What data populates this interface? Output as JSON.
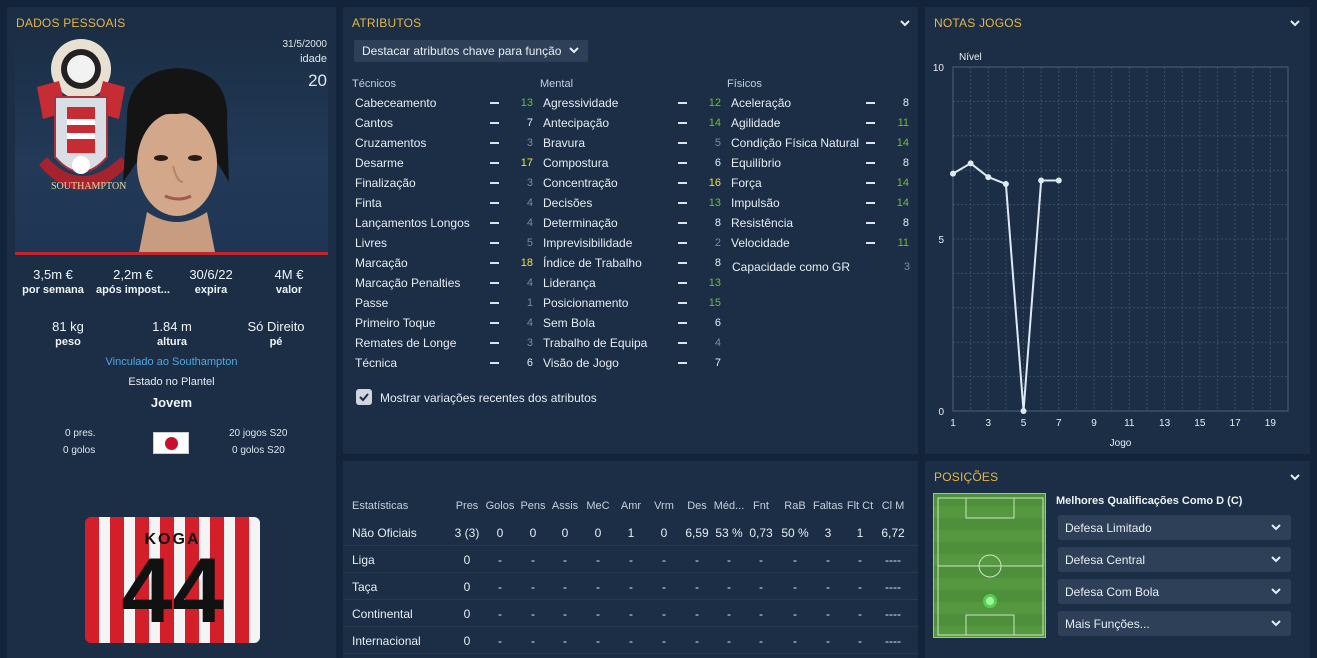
{
  "personal": {
    "title": "DADOS PESSOAIS",
    "dob": "31/5/2000",
    "age_label": "idade",
    "age": "20",
    "wage": {
      "value": "3,5m €",
      "label": "por semana"
    },
    "after_tax": {
      "value": "2,2m €",
      "label": "após impost..."
    },
    "contract": {
      "value": "30/6/22",
      "label": "expira"
    },
    "market_value": {
      "value": "4M €",
      "label": "valor"
    },
    "weight": {
      "value": "81 kg",
      "label": "peso"
    },
    "height": {
      "value": "1.84 m",
      "label": "altura"
    },
    "foot": {
      "value": "Só Direito",
      "label": "pé"
    },
    "club_link": "Vinculado ao Southampton",
    "squad_status_label": "Estado no Plantel",
    "squad_status": "Jovem",
    "caps": "0 pres.",
    "goals": "0 golos",
    "season_games": "20 jogos S20",
    "season_goals": "0 golos S20",
    "shirt_name": "KOGA",
    "shirt_number": "44",
    "crest_text": "SOUTHAMPTON"
  },
  "attributes": {
    "title": "ATRIBUTOS",
    "dropdown": "Destacar atributos chave para função",
    "columns": [
      "Técnicos",
      "Mental",
      "Físicos"
    ],
    "technical": [
      {
        "name": "Cabeceamento",
        "value": "13",
        "c": "#6dbe3a"
      },
      {
        "name": "Cantos",
        "value": "7",
        "c": "#e8edf2"
      },
      {
        "name": "Cruzamentos",
        "value": "3",
        "c": "#7f8b98"
      },
      {
        "name": "Desarme",
        "value": "17",
        "c": "#f2e33c"
      },
      {
        "name": "Finalização",
        "value": "3",
        "c": "#7f8b98"
      },
      {
        "name": "Finta",
        "value": "4",
        "c": "#7f8b98"
      },
      {
        "name": "Lançamentos Longos",
        "value": "4",
        "c": "#7f8b98"
      },
      {
        "name": "Livres",
        "value": "5",
        "c": "#7f8b98"
      },
      {
        "name": "Marcação",
        "value": "18",
        "c": "#f2e33c"
      },
      {
        "name": "Marcação Penalties",
        "value": "4",
        "c": "#7f8b98"
      },
      {
        "name": "Passe",
        "value": "1",
        "c": "#7f8b98"
      },
      {
        "name": "Primeiro Toque",
        "value": "4",
        "c": "#7f8b98"
      },
      {
        "name": "Remates de Longe",
        "value": "3",
        "c": "#7f8b98"
      },
      {
        "name": "Técnica",
        "value": "6",
        "c": "#e8edf2"
      }
    ],
    "mental": [
      {
        "name": "Agressividade",
        "value": "12",
        "c": "#6dbe3a"
      },
      {
        "name": "Antecipação",
        "value": "14",
        "c": "#6dbe3a"
      },
      {
        "name": "Bravura",
        "value": "5",
        "c": "#7f8b98"
      },
      {
        "name": "Compostura",
        "value": "6",
        "c": "#e8edf2"
      },
      {
        "name": "Concentração",
        "value": "16",
        "c": "#f2e33c"
      },
      {
        "name": "Decisões",
        "value": "13",
        "c": "#6dbe3a"
      },
      {
        "name": "Determinação",
        "value": "8",
        "c": "#e8edf2"
      },
      {
        "name": "Imprevisibilidade",
        "value": "2",
        "c": "#7f8b98"
      },
      {
        "name": "Índice de Trabalho",
        "value": "8",
        "c": "#e8edf2"
      },
      {
        "name": "Liderança",
        "value": "13",
        "c": "#6dbe3a"
      },
      {
        "name": "Posicionamento",
        "value": "15",
        "c": "#6dbe3a"
      },
      {
        "name": "Sem Bola",
        "value": "6",
        "c": "#e8edf2"
      },
      {
        "name": "Trabalho de Equipa",
        "value": "4",
        "c": "#7f8b98"
      },
      {
        "name": "Visão de Jogo",
        "value": "7",
        "c": "#e8edf2"
      }
    ],
    "physical": [
      {
        "name": "Aceleração",
        "value": "8",
        "c": "#e8edf2"
      },
      {
        "name": "Agilidade",
        "value": "11",
        "c": "#6dbe3a"
      },
      {
        "name": "Condição Física Natural",
        "value": "14",
        "c": "#6dbe3a"
      },
      {
        "name": "Equilíbrio",
        "value": "8",
        "c": "#e8edf2"
      },
      {
        "name": "Força",
        "value": "14",
        "c": "#6dbe3a"
      },
      {
        "name": "Impulsão",
        "value": "14",
        "c": "#6dbe3a"
      },
      {
        "name": "Resistência",
        "value": "8",
        "c": "#e8edf2"
      },
      {
        "name": "Velocidade",
        "value": "11",
        "c": "#6dbe3a"
      }
    ],
    "gk_label": "Capacidade como GR",
    "gk_value": "3",
    "checkbox_label": "Mostrar variações recentes dos atributos",
    "checkbox_checked": true
  },
  "stats": {
    "headers": [
      "Estatísticas",
      "Pres",
      "Golos",
      "Pens",
      "Assis",
      "MeC",
      "Amr",
      "Vrm",
      "Des",
      "Méd...",
      "Fnt",
      "RaB",
      "Faltas",
      "Flt Ct",
      "Cl M"
    ],
    "rows": [
      [
        "Não Oficiais",
        "3 (3)",
        "0",
        "0",
        "0",
        "0",
        "1",
        "0",
        "6,59",
        "53 %",
        "0,73",
        "50 %",
        "3",
        "1",
        "6,72"
      ],
      [
        "Liga",
        "0",
        "-",
        "-",
        "-",
        "-",
        "-",
        "-",
        "-",
        "-",
        "-",
        "-",
        "-",
        "-",
        "----"
      ],
      [
        "Taça",
        "0",
        "-",
        "-",
        "-",
        "-",
        "-",
        "-",
        "-",
        "-",
        "-",
        "-",
        "-",
        "-",
        "----"
      ],
      [
        "Continental",
        "0",
        "-",
        "-",
        "-",
        "-",
        "-",
        "-",
        "-",
        "-",
        "-",
        "-",
        "-",
        "-",
        "----"
      ],
      [
        "Internacional",
        "0",
        "-",
        "-",
        "-",
        "-",
        "-",
        "-",
        "-",
        "-",
        "-",
        "-",
        "-",
        "-",
        "----"
      ]
    ]
  },
  "chart_data": {
    "type": "line",
    "title": "NOTAS JOGOS",
    "ylabel": "Nível",
    "xlabel": "Jogo",
    "x": [
      1,
      2,
      3,
      4,
      5,
      6,
      7
    ],
    "series": [
      {
        "values": [
          6.9,
          7.2,
          6.8,
          6.6,
          0,
          6.7,
          6.7
        ]
      }
    ],
    "ylim": [
      0,
      10
    ],
    "xlim": [
      1,
      20
    ],
    "yticks": [
      "0",
      "5",
      "10"
    ],
    "xticks": [
      "1",
      "3",
      "5",
      "7",
      "9",
      "11",
      "13",
      "15",
      "17",
      "19"
    ],
    "grid": true,
    "line_color": "#dfe9f5"
  },
  "positions": {
    "title": "POSIÇÕES",
    "best_role": "Melhores Qualificações Como D (C)",
    "roles": [
      "Defesa Limitado",
      "Defesa Central",
      "Defesa Com Bola",
      "Mais Funções..."
    ],
    "pitch_position": "D (C)"
  }
}
